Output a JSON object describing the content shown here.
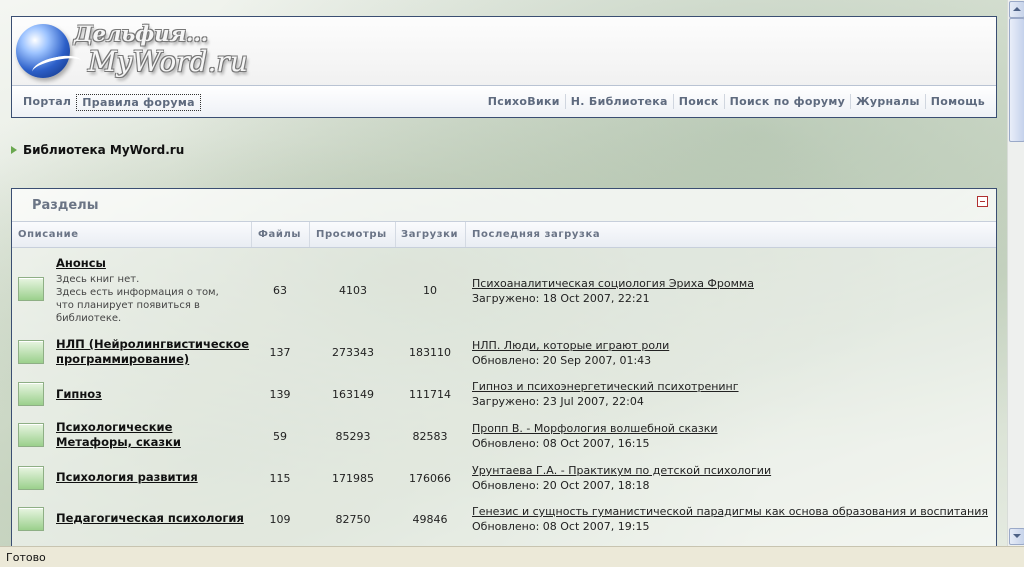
{
  "logo": {
    "line1": "Дельфия...",
    "line2": "MyWord.ru"
  },
  "nav_left": [
    "Портал",
    "Правила форума"
  ],
  "nav_right": [
    "ПсихоВики",
    "Н. Библиотека",
    "Поиск",
    "Поиск по форуму",
    "Журналы",
    "Помощь"
  ],
  "breadcrumb": "Библиотека MyWord.ru",
  "sections": {
    "title": "Разделы",
    "columns": [
      "Описание",
      "Файлы",
      "Просмотры",
      "Загрузки",
      "Последняя загрузка"
    ],
    "rows": [
      {
        "name": "Анонсы",
        "desc": [
          "Здесь книг нет.",
          "Здесь есть информация о том,",
          "что планирует появиться в",
          "библиотеке."
        ],
        "files": "63",
        "views": "4103",
        "downloads": "10",
        "last_title": "Психоаналитическая социология Эриха Фромма",
        "last_date": "Загружено: 18 Oct 2007, 22:21"
      },
      {
        "name": "НЛП (Нейролингвистическое программирование)",
        "name_lines": [
          "НЛП (Нейролингвистическое",
          "программирование)"
        ],
        "files": "137",
        "views": "273343",
        "downloads": "183110",
        "last_title": "НЛП. Люди, которые играют роли",
        "last_date": "Обновлено: 20 Sep 2007, 01:43"
      },
      {
        "name": "Гипноз",
        "files": "139",
        "views": "163149",
        "downloads": "111714",
        "last_title": "Гипноз и психоэнергетический психотренинг",
        "last_date": "Загружено: 23 Jul 2007, 22:04"
      },
      {
        "name": "Психологические Метафоры, сказки",
        "name_lines": [
          "Психологические",
          "Метафоры, сказки"
        ],
        "files": "59",
        "views": "85293",
        "downloads": "82583",
        "last_title": "Пропп В. - Морфология волшебной сказки",
        "last_date": "Обновлено: 08 Oct 2007, 16:15"
      },
      {
        "name": "Психология развития",
        "files": "115",
        "views": "171985",
        "downloads": "176066",
        "last_title": "Урунтаева Г.А. - Практикум по детской психологии",
        "last_date": "Обновлено: 20 Oct 2007, 18:18"
      },
      {
        "name": "Педагогическая психология",
        "files": "109",
        "views": "82750",
        "downloads": "49846",
        "last_title": "Генезис и сущность гуманистической парадигмы как основа образования и воспитания",
        "last_date": "Обновлено: 08 Oct 2007, 19:15"
      }
    ]
  },
  "status_bar": "Готово"
}
